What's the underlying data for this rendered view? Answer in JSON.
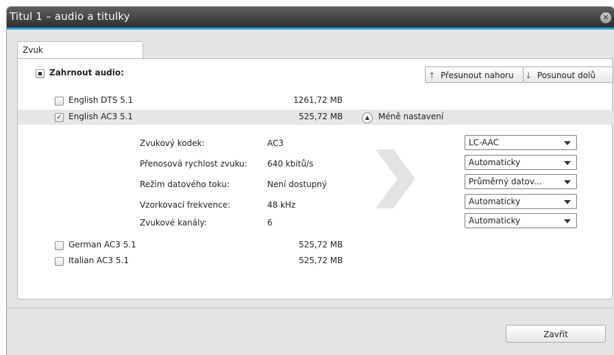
{
  "window": {
    "title": "Titul 1 – audio a titulky",
    "close_glyph": "✕"
  },
  "tabs": [
    {
      "label": "Zvuk"
    }
  ],
  "audio": {
    "include_label": "Zahrnout audio:",
    "buttons": {
      "move_up": "Přesunout nahoru",
      "move_down": "Posunout dolů"
    },
    "tracks": [
      {
        "name": "English DTS 5.1",
        "size": "1261,72 MB",
        "checked": false
      },
      {
        "name": "English AC3 5.1",
        "size": "525,72 MB",
        "checked": true
      },
      {
        "name": "German AC3 5.1",
        "size": "525,72 MB",
        "checked": false
      },
      {
        "name": "Italian AC3 5.1",
        "size": "525,72 MB",
        "checked": false
      }
    ],
    "less_settings_label": "Méně nastavení",
    "details": [
      {
        "label": "Zvukový kodek:",
        "value": "AC3",
        "select": "LC-AAC"
      },
      {
        "label": "Přenosová rychlost zvuku:",
        "value": "640 kbitů/s",
        "select": "Automaticky"
      },
      {
        "label": "Režim datového toku:",
        "value": "Není dostupný",
        "select": "Průměrný datov..."
      },
      {
        "label": "Vzorkovací frekvence:",
        "value": "48 kHz",
        "select": "Automaticky"
      },
      {
        "label": "Zvukové kanály:",
        "value": "6",
        "select": "Automaticky"
      }
    ]
  },
  "footer": {
    "close_label": "Zavřít"
  },
  "icons": {
    "up_arrow": "arrow-up-icon",
    "down_arrow": "arrow-down-icon",
    "collapse": "chevron-up-circle-icon",
    "convert": "chevron-right-icon"
  },
  "colors": {
    "accent": "#1f9fd6",
    "titlebar": "#3a3a3a"
  }
}
